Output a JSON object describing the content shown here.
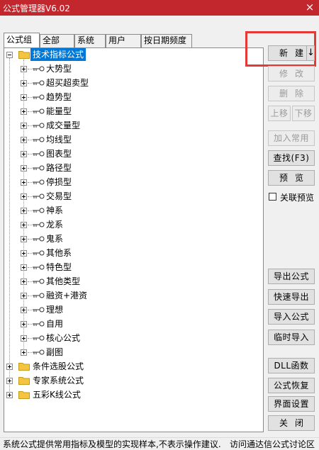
{
  "window": {
    "title": "公式管理器V6.02",
    "close_symbol": "×"
  },
  "tabs": [
    {
      "label": "公式组",
      "active": true
    },
    {
      "label": "全部",
      "active": false
    },
    {
      "label": "系统",
      "active": false
    },
    {
      "label": "用户",
      "active": false
    },
    {
      "label": "按日期频度",
      "active": false
    }
  ],
  "tree": {
    "root": {
      "label": "技术指标公式",
      "expanded": true,
      "selected": true
    },
    "children": [
      "大势型",
      "超买超卖型",
      "趋势型",
      "能量型",
      "成交量型",
      "均线型",
      "图表型",
      "路径型",
      "停损型",
      "交易型",
      "神系",
      "龙系",
      "鬼系",
      "其他系",
      "特色型",
      "其他类型",
      "融资+港资",
      "理想",
      "自用",
      "核心公式",
      "副图"
    ],
    "other_roots": [
      "条件选股公式",
      "专家系统公式",
      "五彩K线公式"
    ]
  },
  "buttons": {
    "new": "新建",
    "new_arrow": "↓",
    "modify": "修改",
    "delete": "删除",
    "move_up": "上移",
    "move_down": "下移",
    "add_common": "加入常用",
    "find": "查找(F3)",
    "preview": "预览",
    "export": "导出公式",
    "quick_export": "快速导出",
    "import": "导入公式",
    "temp_import": "临时导入",
    "dll": "DLL函数",
    "restore": "公式恢复",
    "ui_settings": "界面设置",
    "close": "关闭"
  },
  "checkbox": {
    "label": "关联预览",
    "checked": false
  },
  "status": {
    "left": "系统公式提供常用指标及模型的实现样本,不表示操作建议.",
    "right": "访问通达信公式讨论区"
  },
  "colors": {
    "titlebar": "#c1272d",
    "selection": "#0078d7",
    "highlight_box": "#e53935",
    "folder": "#f5c542"
  }
}
